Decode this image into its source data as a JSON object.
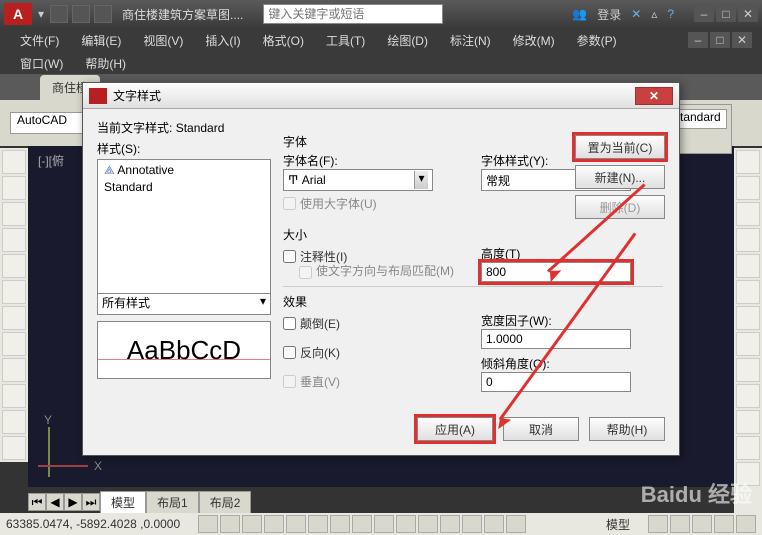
{
  "app": {
    "logo_text": "A",
    "doc_title": "商住楼建筑方案草图....",
    "search_placeholder": "键入关键字或短语",
    "login": "登录",
    "help_icon": "?"
  },
  "menu": {
    "file": "文件(F)",
    "edit": "编辑(E)",
    "view": "视图(V)",
    "insert": "插入(I)",
    "format": "格式(O)",
    "tools": "工具(T)",
    "draw": "绘图(D)",
    "dimension": "标注(N)",
    "modify": "修改(M)",
    "params": "参数(P)",
    "window": "窗口(W)",
    "help": "帮助(H)"
  },
  "doc_tab": "商住楼",
  "top_panel": {
    "autocad": "AutoCAD"
  },
  "viewport": "[-][俯",
  "layout": {
    "model": "模型",
    "layout1": "布局1",
    "layout2": "布局2"
  },
  "status": {
    "coords": "63385.0474, -5892.4028 ,0.0000",
    "model": "模型"
  },
  "style_panel": {
    "standard": "Standard"
  },
  "dialog": {
    "title": "文字样式",
    "current_label": "当前文字样式:",
    "current_value": "Standard",
    "styles_label": "样式(S):",
    "styles": {
      "annotative": "Annotative",
      "standard": "Standard"
    },
    "filter": "所有样式",
    "preview": "AaBbCcD",
    "font_group": "字体",
    "font_name_label": "字体名(F):",
    "font_name": "Arial",
    "font_style_label": "字体样式(Y):",
    "font_style": "常规",
    "big_font": "使用大字体(U)",
    "size_group": "大小",
    "annotative_chk": "注释性(I)",
    "match_orient": "使文字方向与布局匹配(M)",
    "height_label": "高度(T)",
    "height_value": "800",
    "effects_group": "效果",
    "upside_down": "颠倒(E)",
    "backwards": "反向(K)",
    "vertical": "垂直(V)",
    "width_label": "宽度因子(W):",
    "width_value": "1.0000",
    "oblique_label": "倾斜角度(O):",
    "oblique_value": "0",
    "set_current": "置为当前(C)",
    "new": "新建(N)...",
    "delete": "删除(D)",
    "apply": "应用(A)",
    "cancel": "取消",
    "help": "帮助(H)"
  },
  "watermark": "Baidu 经验"
}
